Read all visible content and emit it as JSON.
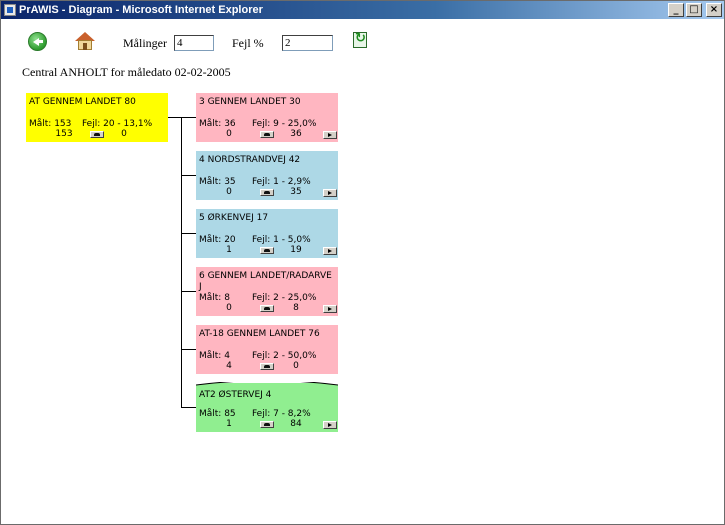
{
  "window": {
    "title": "PrAWIS - Diagram - Microsoft Internet Explorer",
    "minimize": "_",
    "maximize": "□",
    "close": "×"
  },
  "toolbar": {
    "malinger_label": "Målinger",
    "malinger_value": "4",
    "fejl_label": "Fejl %",
    "fejl_value": "2"
  },
  "subtitle": "Central ANHOLT for måledato 02-02-2005",
  "colors": {
    "yellow": "#ffff00",
    "pink": "#ffb6c1",
    "blue": "#add8e6",
    "green": "#90ee90"
  },
  "root": {
    "name": "AT GENNEM LANDET 80",
    "malt": "Målt: 153",
    "fejl": "Fejl: 20 - 13,1%",
    "v1": "153",
    "v2": "0"
  },
  "children": [
    {
      "name": "3 GENNEM LANDET 30",
      "malt": "Målt: 36",
      "fejl": "Fejl: 9 - 25,0%",
      "v1": "0",
      "v2": "36",
      "color": "pink"
    },
    {
      "name": "4 NORDSTRANDVEJ 42",
      "malt": "Målt: 35",
      "fejl": "Fejl: 1 - 2,9%",
      "v1": "0",
      "v2": "35",
      "color": "blue"
    },
    {
      "name": "5 ØRKENVEJ 17",
      "malt": "Målt: 20",
      "fejl": "Fejl: 1 - 5,0%",
      "v1": "1",
      "v2": "19",
      "color": "blue"
    },
    {
      "name": "6 GENNEM LANDET/RADARVE J",
      "malt": "Målt: 8",
      "fejl": "Fejl: 2 - 25,0%",
      "v1": "0",
      "v2": "8",
      "color": "pink"
    },
    {
      "name": "AT-18 GENNEM LANDET 76",
      "malt": "Målt: 4",
      "fejl": "Fejl: 2 - 50,0%",
      "v1": "4",
      "v2": "0",
      "color": "pink"
    },
    {
      "name": "AT2 ØSTERVEJ 4",
      "malt": "Målt: 85",
      "fejl": "Fejl: 7 - 8,2%",
      "v1": "1",
      "v2": "84",
      "color": "green"
    }
  ]
}
